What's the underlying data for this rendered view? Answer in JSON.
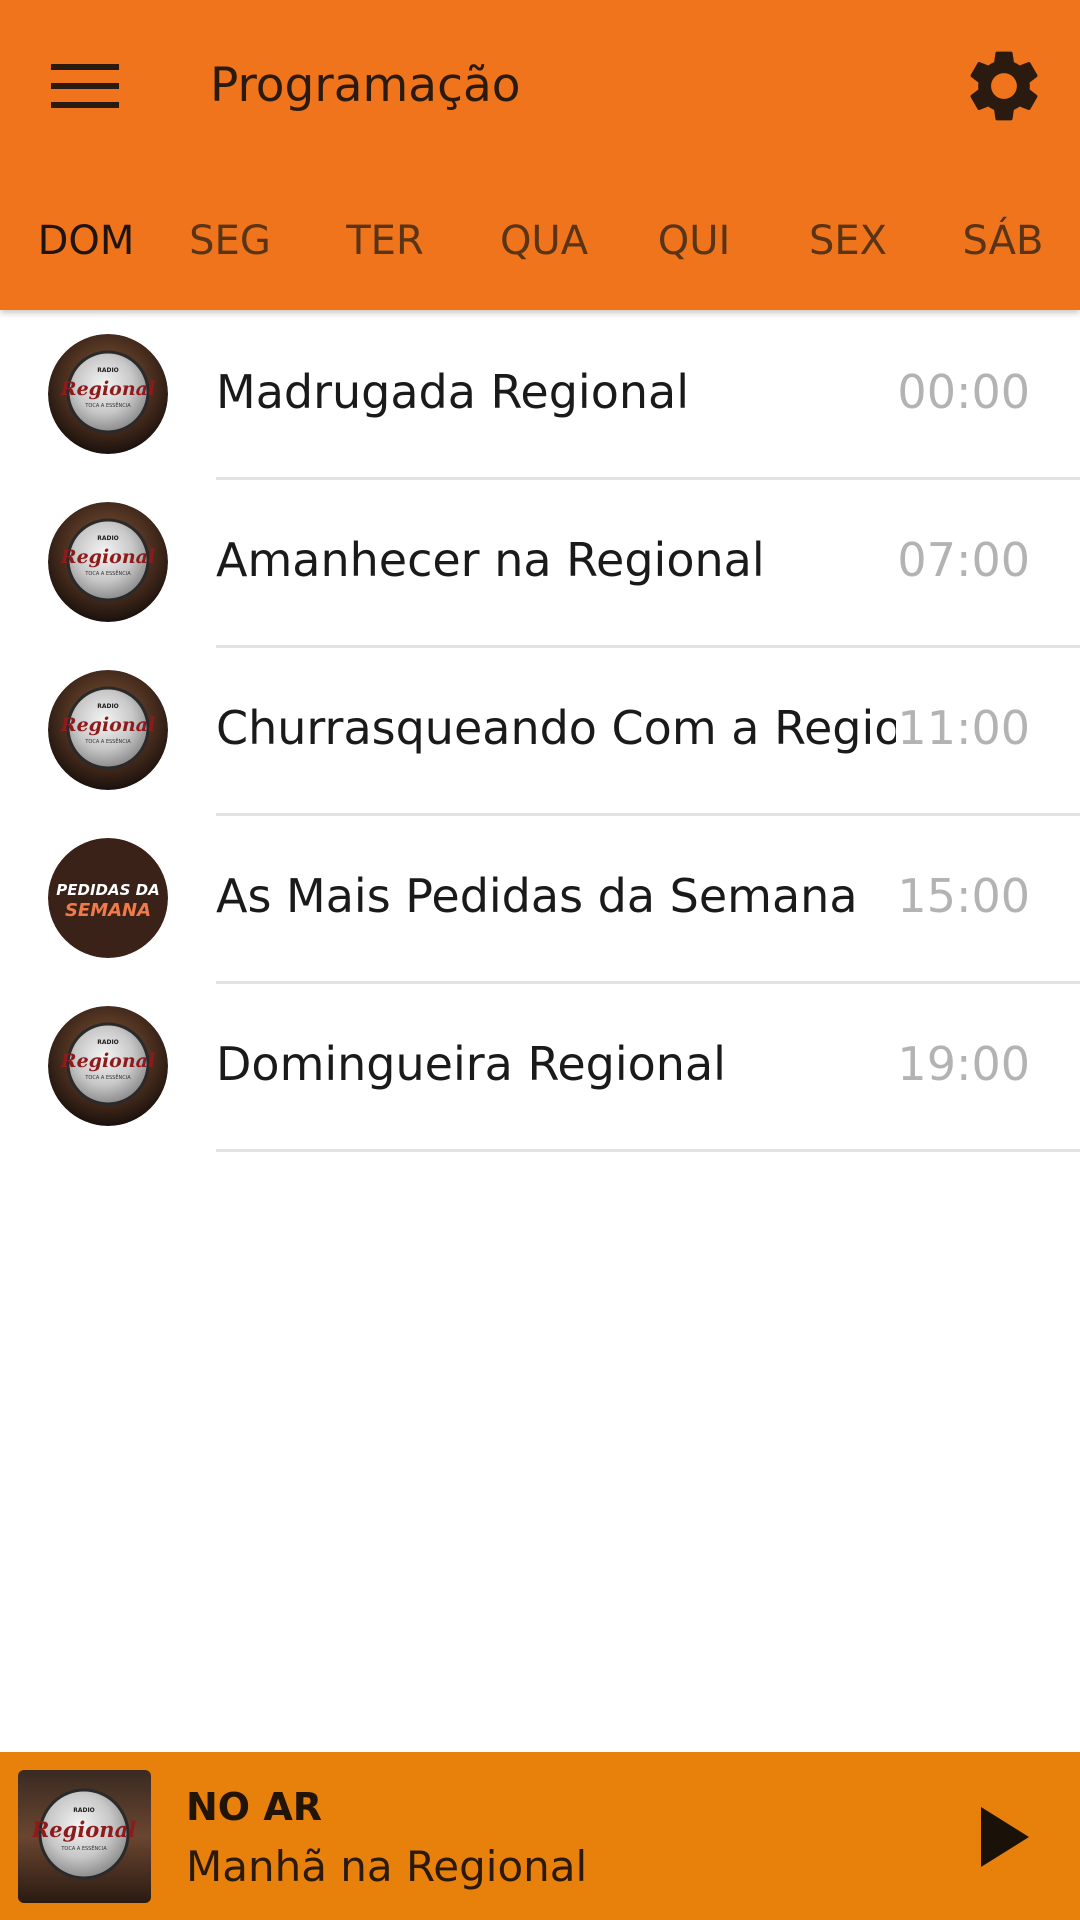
{
  "colors": {
    "appbar": "#ef741b",
    "player": "#e8810b",
    "time_text": "#b3b3b3"
  },
  "header": {
    "title": "Programação",
    "menu_icon": "menu-icon",
    "settings_icon": "gear-icon"
  },
  "tabs": [
    {
      "label": "DOM",
      "active": true
    },
    {
      "label": "SEG",
      "active": false
    },
    {
      "label": "TER",
      "active": false
    },
    {
      "label": "QUA",
      "active": false
    },
    {
      "label": "QUI",
      "active": false
    },
    {
      "label": "SEX",
      "active": false
    },
    {
      "label": "SÁB",
      "active": false
    }
  ],
  "schedule": [
    {
      "title": "Madrugada Regional",
      "time": "00:00",
      "logo": "radio-regional-logo"
    },
    {
      "title": "Amanhecer na Regional",
      "time": "07:00",
      "logo": "radio-regional-logo"
    },
    {
      "title": "Churrasqueando Com a Regio",
      "time": "11:00",
      "logo": "radio-regional-logo"
    },
    {
      "title": "As Mais Pedidas da Semana",
      "time": "15:00",
      "logo": "pedidas-da-semana-logo"
    },
    {
      "title": "Domingueira Regional",
      "time": "19:00",
      "logo": "radio-regional-logo"
    }
  ],
  "logos": {
    "radio_small": "RADIO",
    "regional": "Regional",
    "tagline": "TOCA A ESSÊNCIA",
    "pedidas_line1": "PEDIDAS DA",
    "pedidas_line2": "SEMANA"
  },
  "player": {
    "label": "NO AR",
    "show": "Manhã na Regional",
    "play_icon": "play-icon"
  }
}
